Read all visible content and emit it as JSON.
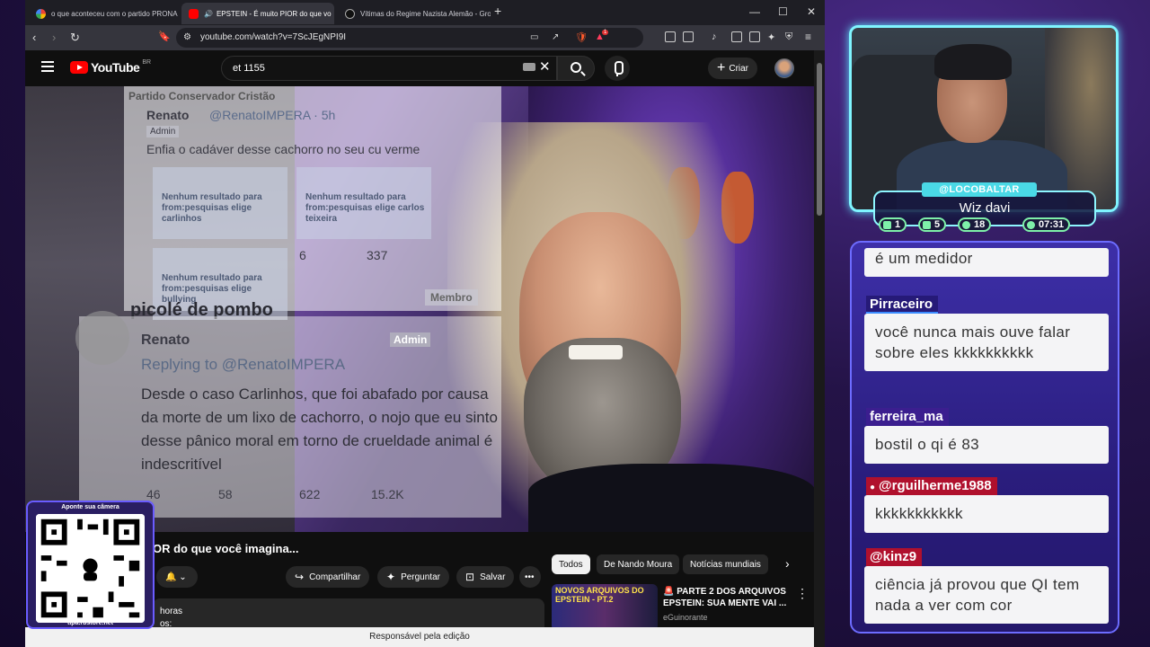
{
  "browser": {
    "tabs": [
      {
        "title": "o que aconteceu com o partido PRONA - Pe"
      },
      {
        "title": "EPSTEIN - É muito PIOR do que vo"
      },
      {
        "title": "Vítimas do Regime Nazista Alemão - Grok"
      }
    ],
    "url": "youtube.com/watch?v=7ScJEgNPI9I",
    "status": "Responsável pela edição",
    "brave_count": "1"
  },
  "youtube": {
    "logo_text": "YouTube",
    "country": "BR",
    "search_value": "et 1155",
    "create_label": "Criar",
    "video_title": "OR do que você imagina...",
    "actions": {
      "share": "Compartilhar",
      "ask": "Perguntar",
      "save": "Salvar"
    },
    "description": {
      "line1": "horas",
      "line2": "os:"
    },
    "chips": [
      "Todos",
      "De Nando Moura",
      "Notícias mundiais"
    ],
    "recommendation": {
      "thumb_text": "NOVOS ARQUIVOS DO EPSTEIN - PT.2",
      "title": "🚨 PARTE 2 DOS ARQUIVOS EPSTEIN: SUA MENTE VAI ...",
      "channel": "eGuinorante"
    }
  },
  "tweet_overlay": {
    "group": "Partido Conservador Cristão",
    "author": "Renato",
    "handle": "@RenatoIMPERA · 5h",
    "badge": "Admin",
    "text": "Enfia o cadáver desse cachorro no seu cu verme",
    "cells": [
      "Nenhum resultado para from:pesquisas elige carlinhos",
      "Nenhum resultado para from:pesquisas elige carlos teixeira",
      "Nenhum resultado para from:pesquisas elige bullying"
    ],
    "likes": "6",
    "views": "337",
    "reply_line": "picolé de pombo",
    "member": "Membro",
    "reply_author": "Renato",
    "reply_badge": "Admin",
    "replying_to": "Replying to @RenatoIMPERA",
    "reply_text": "Desde o caso Carlinhos, que foi abafado por causa da morte de um lixo de cachorro, o nojo que eu sinto desse pânico moral em torno de crueldade animal é indescritível",
    "replies": "46",
    "reposts": "58",
    "reply_likes": "622",
    "reply_views": "15.2K"
  },
  "qr": {
    "caption": "Aponte sua câmera",
    "url": "tipa.rbstore.net"
  },
  "stream": {
    "handle": "@LOCOBALTAR",
    "game": "Wiz davi",
    "stats": [
      {
        "value": "1",
        "color": "#7ef0a9"
      },
      {
        "value": "5",
        "color": "#7ef0a9"
      },
      {
        "value": "18",
        "color": "#7ef0a9"
      },
      {
        "value": "07:31",
        "color": "#7ef0a9"
      }
    ]
  },
  "chat": [
    {
      "name": "",
      "message": "é um medidor"
    },
    {
      "name": "Pirraceiro",
      "message": "você nunca mais ouve falar sobre eles kkkkkkkkkk"
    },
    {
      "name": "ferreira_ma",
      "message": "bostil o qi é 83"
    },
    {
      "name": "@rguilherme1988",
      "message": "kkkkkkkkkkk"
    },
    {
      "name": "@kinz9",
      "message": "ciência já provou que QI tem nada a ver com cor"
    }
  ]
}
